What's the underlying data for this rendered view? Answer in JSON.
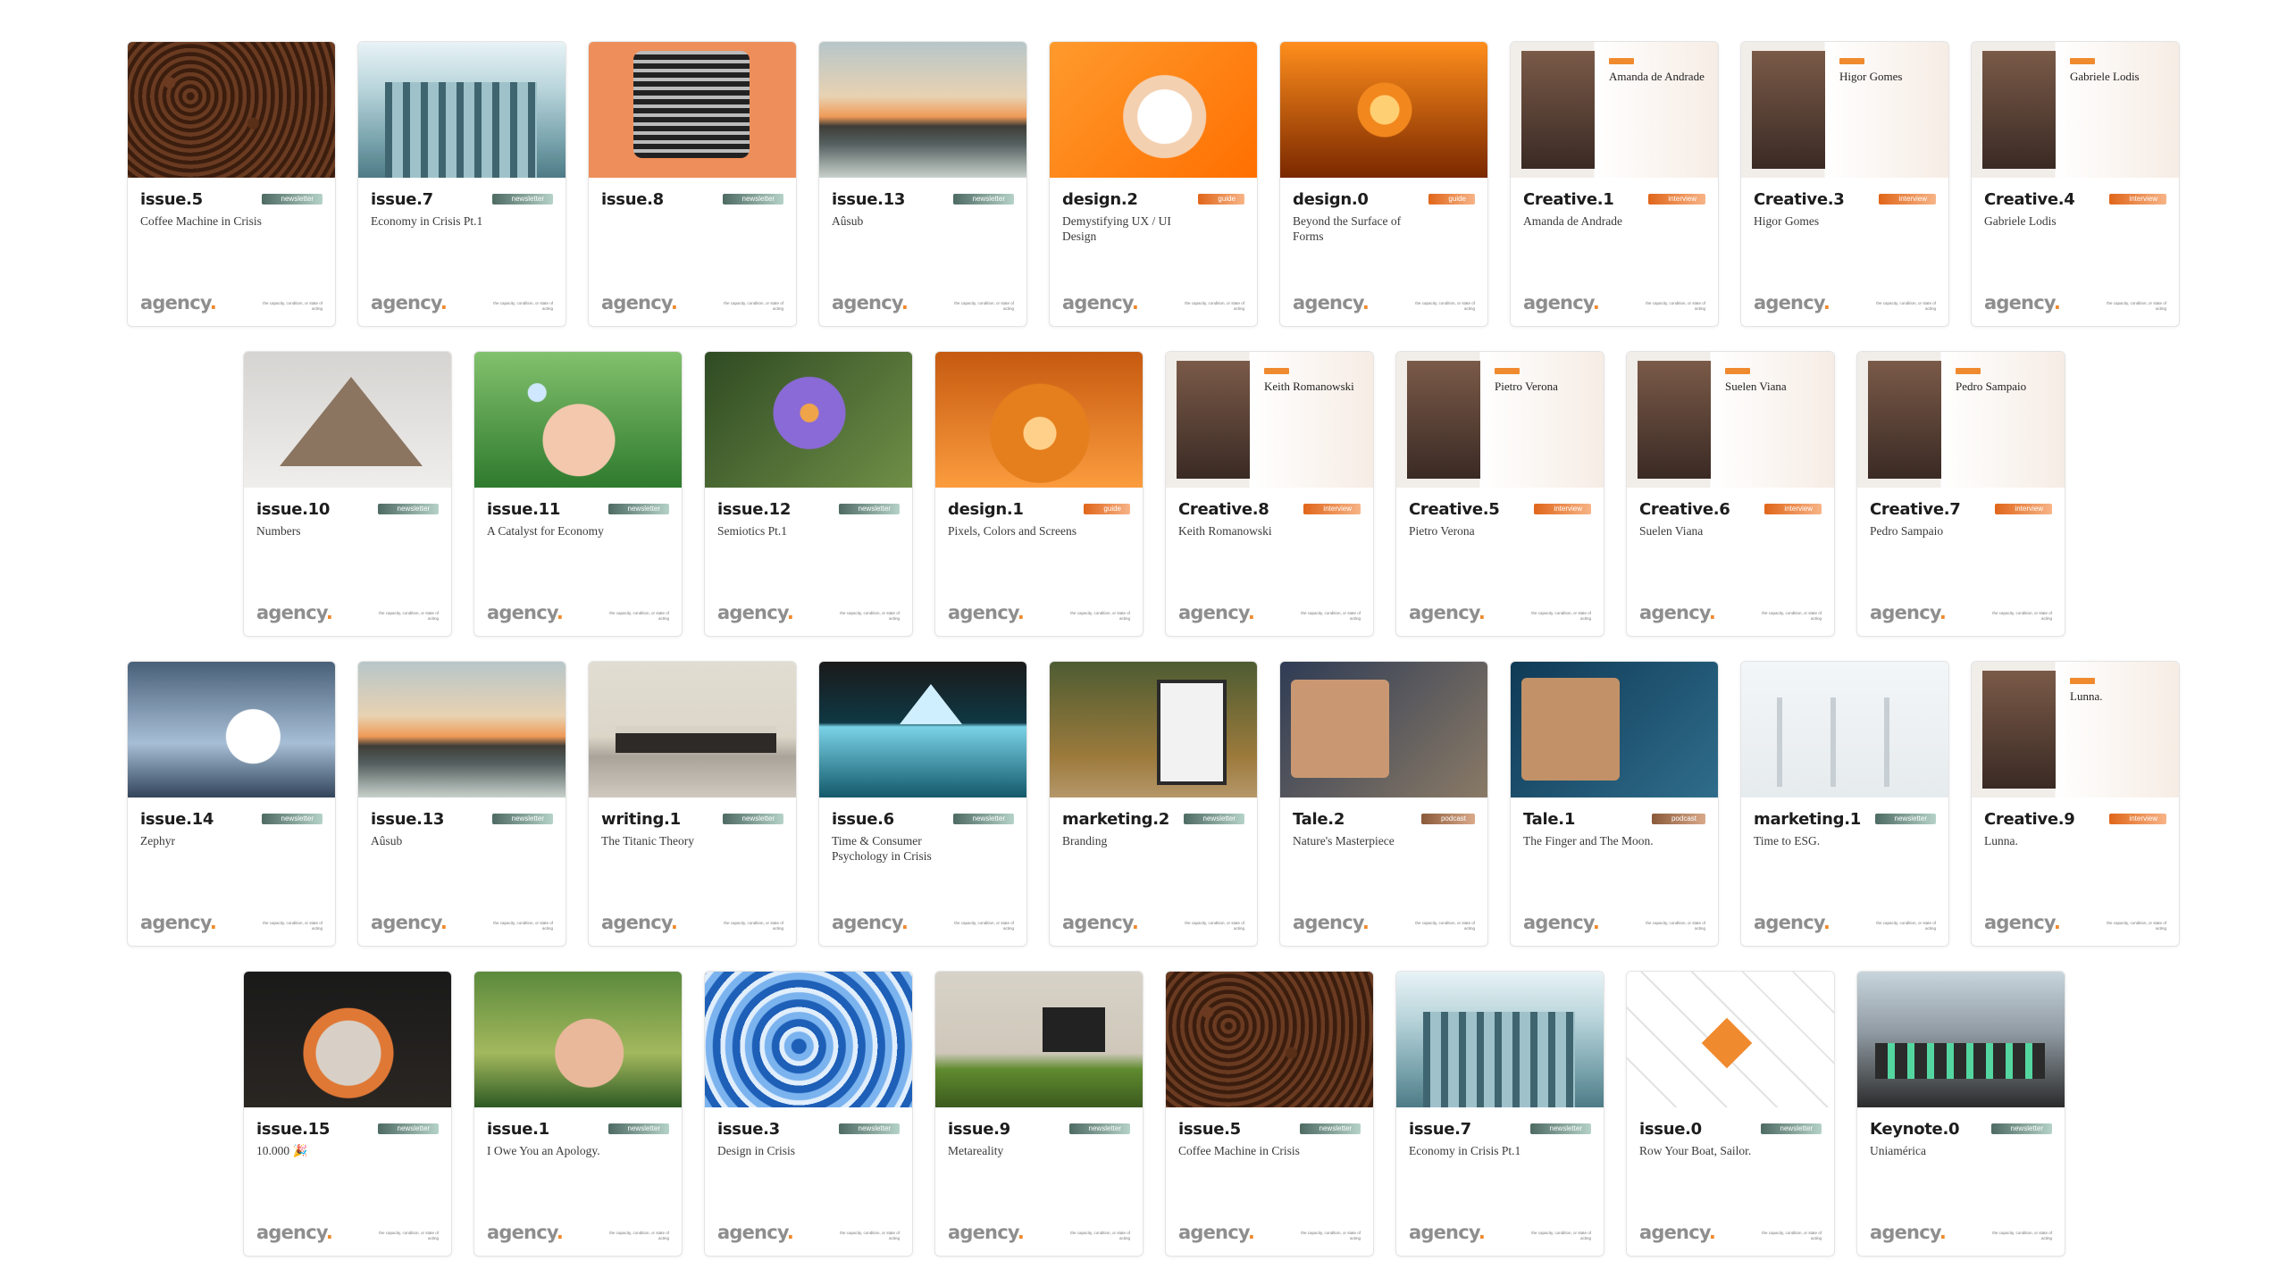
{
  "brand": {
    "logo_text": "agency",
    "logo_dot": ".",
    "footer_note": "the capacity, condition, or state of acting"
  },
  "tag_types": {
    "newsletter": "newsletter",
    "guide": "guide",
    "interview": "interview",
    "podcast": "podcast"
  },
  "rows": [
    {
      "cards": [
        {
          "title": "issue.5",
          "subtitle": "Coffee Machine in Crisis",
          "tag": "newsletter",
          "thumb": "coffee"
        },
        {
          "title": "issue.7",
          "subtitle": "Economy in Crisis Pt.1",
          "tag": "newsletter",
          "thumb": "bank"
        },
        {
          "title": "issue.8",
          "subtitle": "",
          "tag": "newsletter",
          "thumb": "typewriter"
        },
        {
          "title": "issue.13",
          "subtitle": "Aûsub",
          "tag": "newsletter",
          "thumb": "sunset"
        },
        {
          "title": "design.2",
          "subtitle": "Demystifying UX / UI Design",
          "tag": "guide",
          "thumb": "astro"
        },
        {
          "title": "design.0",
          "subtitle": "Beyond the Surface of Forms",
          "tag": "guide",
          "thumb": "feather"
        },
        {
          "title": "Creative.1",
          "subtitle": "Amanda de Andrade",
          "tag": "interview",
          "thumb": "portrait",
          "portrait_name": "Amanda de Andrade"
        },
        {
          "title": "Creative.3",
          "subtitle": "Higor Gomes",
          "tag": "interview",
          "thumb": "portrait",
          "portrait_name": "Higor Gomes"
        },
        {
          "title": "Creative.4",
          "subtitle": "Gabriele Lodis",
          "tag": "interview",
          "thumb": "portrait",
          "portrait_name": "Gabriele Lodis"
        }
      ]
    },
    {
      "cards": [
        {
          "title": "issue.10",
          "subtitle": "Numbers",
          "tag": "newsletter",
          "thumb": "pyramid"
        },
        {
          "title": "issue.11",
          "subtitle": "A Catalyst for Economy",
          "tag": "newsletter",
          "thumb": "hands"
        },
        {
          "title": "issue.12",
          "subtitle": "Semiotics Pt.1",
          "tag": "newsletter",
          "thumb": "lotus"
        },
        {
          "title": "design.1",
          "subtitle": "Pixels, Colors and Screens",
          "tag": "guide",
          "thumb": "desk"
        },
        {
          "title": "Creative.8",
          "subtitle": "Keith Romanowski",
          "tag": "interview",
          "thumb": "portrait",
          "portrait_name": "Keith Romanowski"
        },
        {
          "title": "Creative.5",
          "subtitle": "Pietro Verona",
          "tag": "interview",
          "thumb": "portrait",
          "portrait_name": "Pietro Verona"
        },
        {
          "title": "Creative.6",
          "subtitle": "Suelen Viana",
          "tag": "interview",
          "thumb": "portrait",
          "portrait_name": "Suelen Viana"
        },
        {
          "title": "Creative.7",
          "subtitle": "Pedro Sampaio",
          "tag": "interview",
          "thumb": "portrait",
          "portrait_name": "Pedro Sampaio"
        }
      ]
    },
    {
      "cards": [
        {
          "title": "issue.14",
          "subtitle": "Zephyr",
          "tag": "newsletter",
          "thumb": "cloud"
        },
        {
          "title": "issue.13",
          "subtitle": "Aûsub",
          "tag": "newsletter",
          "thumb": "sunset"
        },
        {
          "title": "writing.1",
          "subtitle": "The Titanic Theory",
          "tag": "newsletter",
          "thumb": "titanic"
        },
        {
          "title": "issue.6",
          "subtitle": "Time & Consumer Psychology in Crisis",
          "tag": "newsletter",
          "thumb": "ice"
        },
        {
          "title": "marketing.2",
          "subtitle": "Branding",
          "tag": "newsletter",
          "thumb": "billboard"
        },
        {
          "title": "Tale.2",
          "subtitle": "Nature's Masterpiece",
          "tag": "podcast",
          "thumb": "tale"
        },
        {
          "title": "Tale.1",
          "subtitle": "The Finger and The Moon.",
          "tag": "podcast",
          "thumb": "tale1"
        },
        {
          "title": "marketing.1",
          "subtitle": "Time to ESG.",
          "tag": "newsletter",
          "thumb": "wind"
        },
        {
          "title": "Creative.9",
          "subtitle": "Lunna.",
          "tag": "interview",
          "thumb": "portrait",
          "portrait_name": "Lunna."
        }
      ]
    },
    {
      "cards": [
        {
          "title": "issue.15",
          "subtitle": "10.000 🎉",
          "tag": "newsletter",
          "thumb": "typer2"
        },
        {
          "title": "issue.1",
          "subtitle": "I Owe You an Apology.",
          "tag": "newsletter",
          "thumb": "soil"
        },
        {
          "title": "issue.3",
          "subtitle": "Design in Crisis",
          "tag": "newsletter",
          "thumb": "abstract"
        },
        {
          "title": "issue.9",
          "subtitle": "Metareality",
          "tag": "newsletter",
          "thumb": "room"
        },
        {
          "title": "issue.5",
          "subtitle": "Coffee Machine in Crisis",
          "tag": "newsletter",
          "thumb": "coffee"
        },
        {
          "title": "issue.7",
          "subtitle": "Economy in Crisis Pt.1",
          "tag": "newsletter",
          "thumb": "bank"
        },
        {
          "title": "issue.0",
          "subtitle": "Row Your Boat, Sailor.",
          "tag": "newsletter",
          "thumb": "tiles"
        },
        {
          "title": "Keynote.0",
          "subtitle": "Uniamérica",
          "tag": "newsletter",
          "thumb": "class"
        }
      ]
    }
  ]
}
